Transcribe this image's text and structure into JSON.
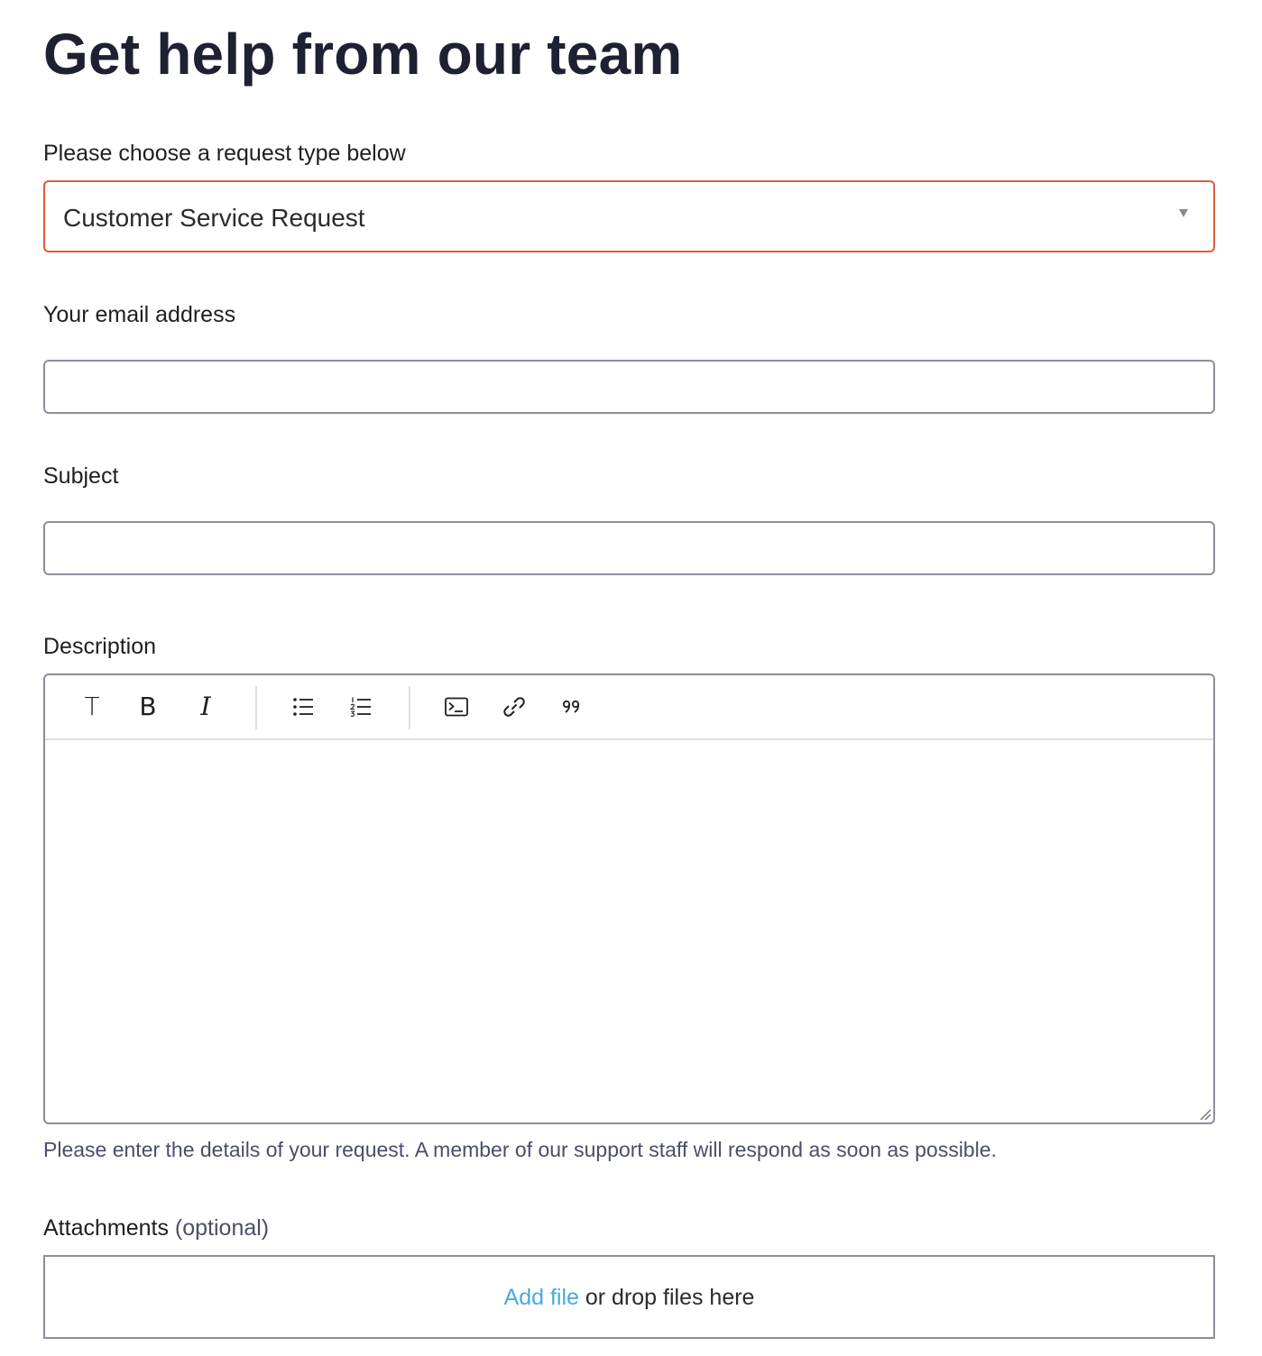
{
  "page_title": "Get help from our team",
  "request_type": {
    "label": "Please choose a request type below",
    "selected": "Customer Service Request"
  },
  "email": {
    "label": "Your email address",
    "value": "",
    "placeholder": ""
  },
  "subject": {
    "label": "Subject",
    "value": "",
    "placeholder": ""
  },
  "description": {
    "label": "Description",
    "toolbar": {
      "text_style": "T",
      "bold": "B",
      "italic": "I"
    },
    "hint": "Please enter the details of your request. A member of our support staff will respond as soon as possible."
  },
  "attachments": {
    "label": "Attachments",
    "optional": "(optional)",
    "add_file": "Add file",
    "drop_text": "or drop files here"
  },
  "colors": {
    "title": "#1d2132",
    "select_border_error": "#e05a3c",
    "input_border": "#8a8f99",
    "link": "#4aa8e0",
    "hint": "#4a4e68"
  }
}
